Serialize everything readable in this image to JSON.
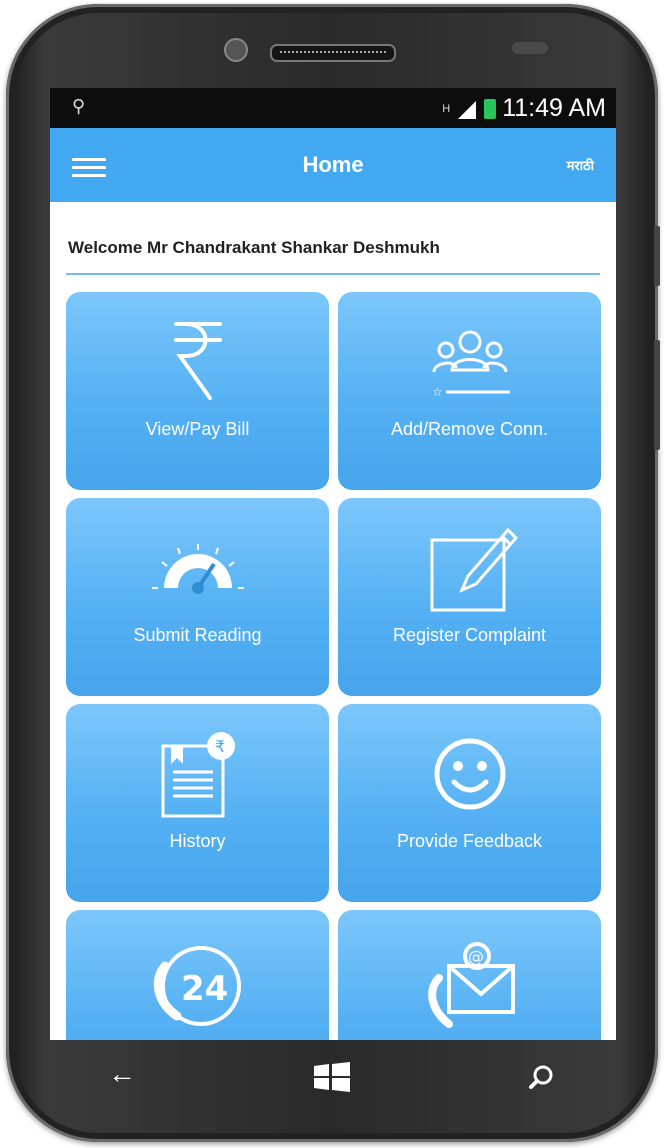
{
  "status_bar": {
    "time": "11:49 AM",
    "network_glyph": "H"
  },
  "app_bar": {
    "title": "Home",
    "language_link": "मराठी"
  },
  "welcome_text": "Welcome Mr Chandrakant Shankar Deshmukh",
  "tiles": [
    {
      "label": "View/Pay Bill",
      "icon": "rupee-icon"
    },
    {
      "label": "Add/Remove Conn.",
      "icon": "users-icon"
    },
    {
      "label": "Submit Reading",
      "icon": "speedometer-icon"
    },
    {
      "label": "Register Complaint",
      "icon": "edit-icon"
    },
    {
      "label": "History",
      "icon": "bill-history-icon"
    },
    {
      "label": "Provide Feedback",
      "icon": "smiley-icon"
    },
    {
      "label": "",
      "icon": "phone-24-icon",
      "icon_text": "24"
    },
    {
      "label": "",
      "icon": "contact-mail-icon",
      "icon_text": "@"
    }
  ],
  "colors": {
    "app_bar": "#42a8f2",
    "tile": "#55b1f3",
    "divider": "#74bcf0"
  }
}
